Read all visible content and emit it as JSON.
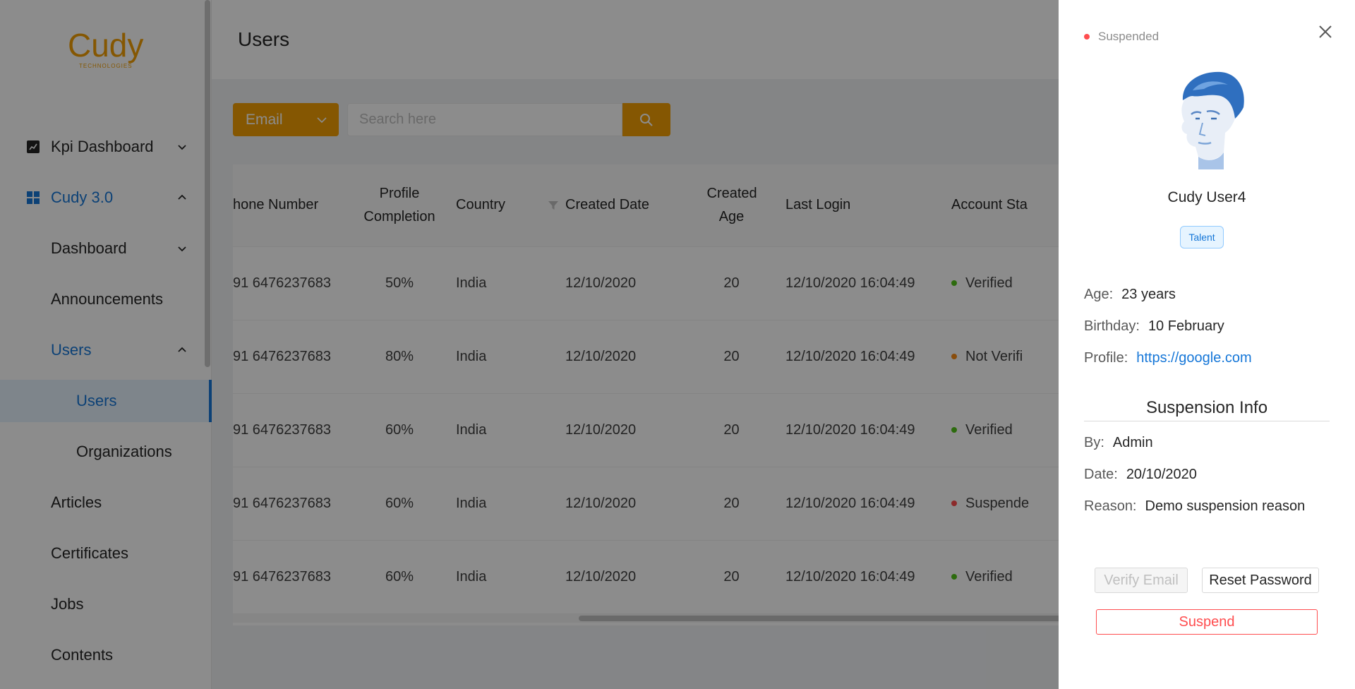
{
  "brand": {
    "logo_text": "Cudy",
    "logo_sub": "TECHNOLOGIES"
  },
  "colors": {
    "accent": "#f29f05",
    "primary": "#1677d8",
    "success": "#52c41a",
    "warning": "#fa8c16",
    "danger": "#ff4d4f"
  },
  "sidebar": {
    "items": [
      {
        "label": "Kpi Dashboard",
        "icon": "kpi-icon"
      },
      {
        "label": "Cudy 3.0",
        "icon": "grid-icon"
      },
      {
        "label": "Dashboard"
      },
      {
        "label": "Announcements"
      },
      {
        "label": "Users"
      },
      {
        "label": "Users"
      },
      {
        "label": "Organizations"
      },
      {
        "label": "Articles"
      },
      {
        "label": "Certificates"
      },
      {
        "label": "Jobs"
      },
      {
        "label": "Contents"
      }
    ]
  },
  "header": {
    "title": "Users"
  },
  "search": {
    "filter_value": "Email",
    "placeholder": "Search here"
  },
  "table": {
    "columns": [
      "hone Number",
      "Profile Completion",
      "Country",
      "Created Date",
      "Created Age",
      "Last Login",
      "Account Sta"
    ],
    "rows": [
      {
        "phone": "91 6476237683",
        "profile": "50%",
        "country": "India",
        "created": "12/10/2020",
        "age": "20",
        "last_login": "12/10/2020 16:04:49",
        "status": "Verified",
        "status_color": "#52c41a"
      },
      {
        "phone": "91 6476237683",
        "profile": "80%",
        "country": "India",
        "created": "12/10/2020",
        "age": "20",
        "last_login": "12/10/2020 16:04:49",
        "status": "Not Verifi",
        "status_color": "#fa8c16"
      },
      {
        "phone": "91 6476237683",
        "profile": "60%",
        "country": "India",
        "created": "12/10/2020",
        "age": "20",
        "last_login": "12/10/2020 16:04:49",
        "status": "Verified",
        "status_color": "#52c41a"
      },
      {
        "phone": "91 6476237683",
        "profile": "60%",
        "country": "India",
        "created": "12/10/2020",
        "age": "20",
        "last_login": "12/10/2020 16:04:49",
        "status": "Suspende",
        "status_color": "#ff4d4f"
      },
      {
        "phone": "91 6476237683",
        "profile": "60%",
        "country": "India",
        "created": "12/10/2020",
        "age": "20",
        "last_login": "12/10/2020 16:04:49",
        "status": "Verified",
        "status_color": "#52c41a"
      }
    ]
  },
  "drawer": {
    "status": "Suspended",
    "user_name": "Cudy User4",
    "role_tag": "Talent",
    "age_label": "Age:",
    "age_value": "23 years",
    "birthday_label": "Birthday:",
    "birthday_value": "10 February",
    "profile_label": "Profile:",
    "profile_value": "https://google.com",
    "suspension_title": "Suspension Info",
    "by_label": "By:",
    "by_value": "Admin",
    "date_label": "Date:",
    "date_value": "20/10/2020",
    "reason_label": "Reason:",
    "reason_value": "Demo suspension reason",
    "verify_email_label": "Verify Email",
    "reset_password_label": "Reset Password",
    "suspend_label": "Suspend"
  }
}
